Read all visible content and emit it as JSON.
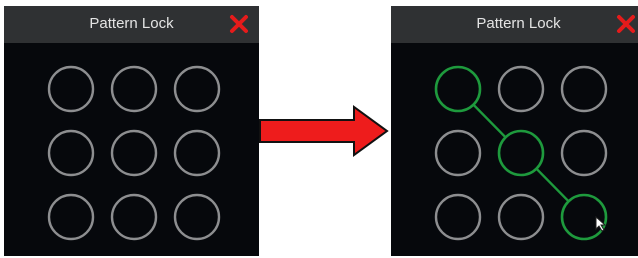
{
  "left_dialog": {
    "title": "Pattern Lock",
    "close_icon": "close-x-icon",
    "selected_dots": []
  },
  "right_dialog": {
    "title": "Pattern Lock",
    "close_icon": "close-x-icon",
    "selected_dots": [
      1,
      5,
      9
    ]
  },
  "transition_icon": "right-arrow-icon",
  "cursor_icon": "mouse-pointer-icon",
  "colors": {
    "panel_bg": "#06080c",
    "titlebar_bg": "#2f3133",
    "title_text": "#e4e4e4",
    "close": "#e51b1b",
    "dot_idle": "#8d8e90",
    "dot_selected": "#1e9a3d",
    "arrow_fill": "#ee1c1c",
    "arrow_stroke": "#111111"
  }
}
